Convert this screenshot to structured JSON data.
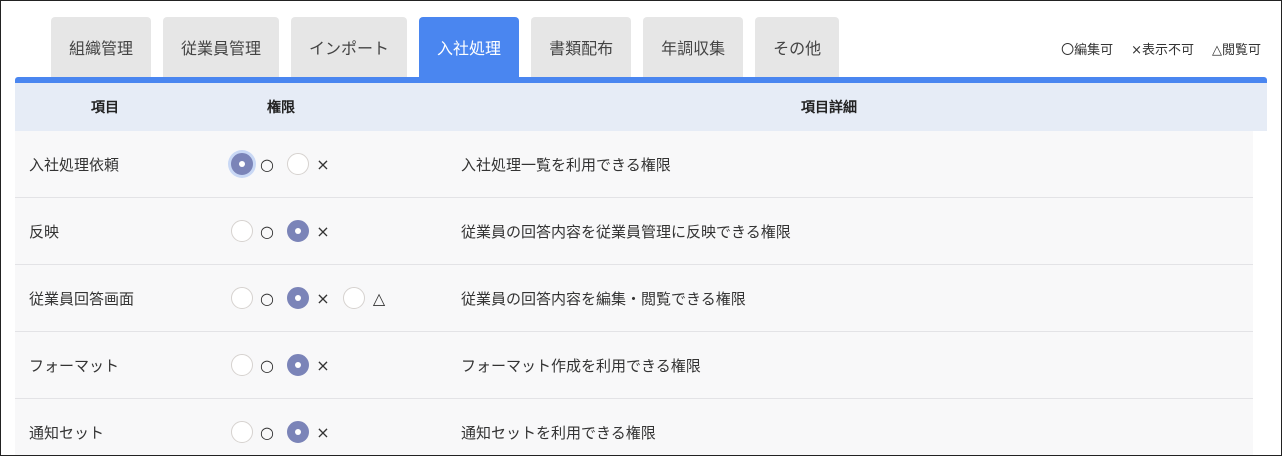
{
  "tabs": [
    {
      "label": "組織管理",
      "active": false
    },
    {
      "label": "従業員管理",
      "active": false
    },
    {
      "label": "インポート",
      "active": false
    },
    {
      "label": "入社処理",
      "active": true
    },
    {
      "label": "書類配布",
      "active": false
    },
    {
      "label": "年調収集",
      "active": false
    },
    {
      "label": "その他",
      "active": false
    }
  ],
  "legend": {
    "edit": "〇編集可",
    "hidden": "×表示不可",
    "view": "△閲覧可"
  },
  "header": {
    "item": "項目",
    "permission": "権限",
    "detail": "項目詳細"
  },
  "symbols": {
    "edit": "○",
    "hidden": "×",
    "view": "△"
  },
  "rows": [
    {
      "item": "入社処理依頼",
      "detail": "入社処理一覧を利用できる権限",
      "selected": "edit"
    },
    {
      "item": "反映",
      "detail": "従業員の回答内容を従業員管理に反映できる権限",
      "selected": "hidden"
    },
    {
      "item": "従業員回答画面",
      "detail": "従業員の回答内容を編集・閲覧できる権限",
      "selected": "hidden"
    },
    {
      "item": "フォーマット",
      "detail": "フォーマット作成を利用できる権限",
      "selected": "hidden"
    },
    {
      "item": "通知セット",
      "detail": "通知セットを利用できる権限",
      "selected": "hidden"
    }
  ],
  "colors": {
    "accent": "#4a86f0",
    "header_bg": "#e6ecf6",
    "radio_on": "#7b84b8"
  }
}
